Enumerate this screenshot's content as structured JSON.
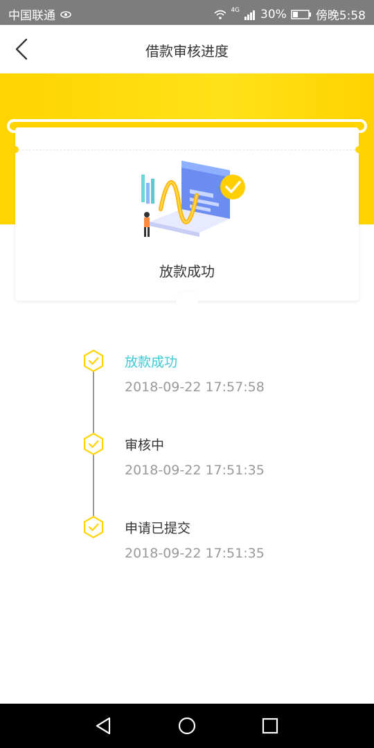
{
  "statusbar": {
    "carrier": "中国联通",
    "network": "4G",
    "battery": "30%",
    "time": "傍晚5:58"
  },
  "header": {
    "title": "借款审核进度"
  },
  "card": {
    "status_title": "放款成功"
  },
  "timeline": [
    {
      "label": "放款成功",
      "time": "2018-09-22 17:57:58",
      "active": true
    },
    {
      "label": "审核中",
      "time": "2018-09-22 17:51:35",
      "active": false
    },
    {
      "label": "申请已提交",
      "time": "2018-09-22 17:51:35",
      "active": false
    }
  ],
  "colors": {
    "accent_yellow": "#ffd400",
    "active_cyan": "#3ec9d4",
    "text_main": "#333333",
    "text_muted": "#999999"
  },
  "icons": {
    "back": "chevron-left-icon",
    "check": "hexagon-check-icon",
    "nav_back": "triangle-back-icon",
    "nav_home": "circle-home-icon",
    "nav_recent": "square-recent-icon"
  }
}
